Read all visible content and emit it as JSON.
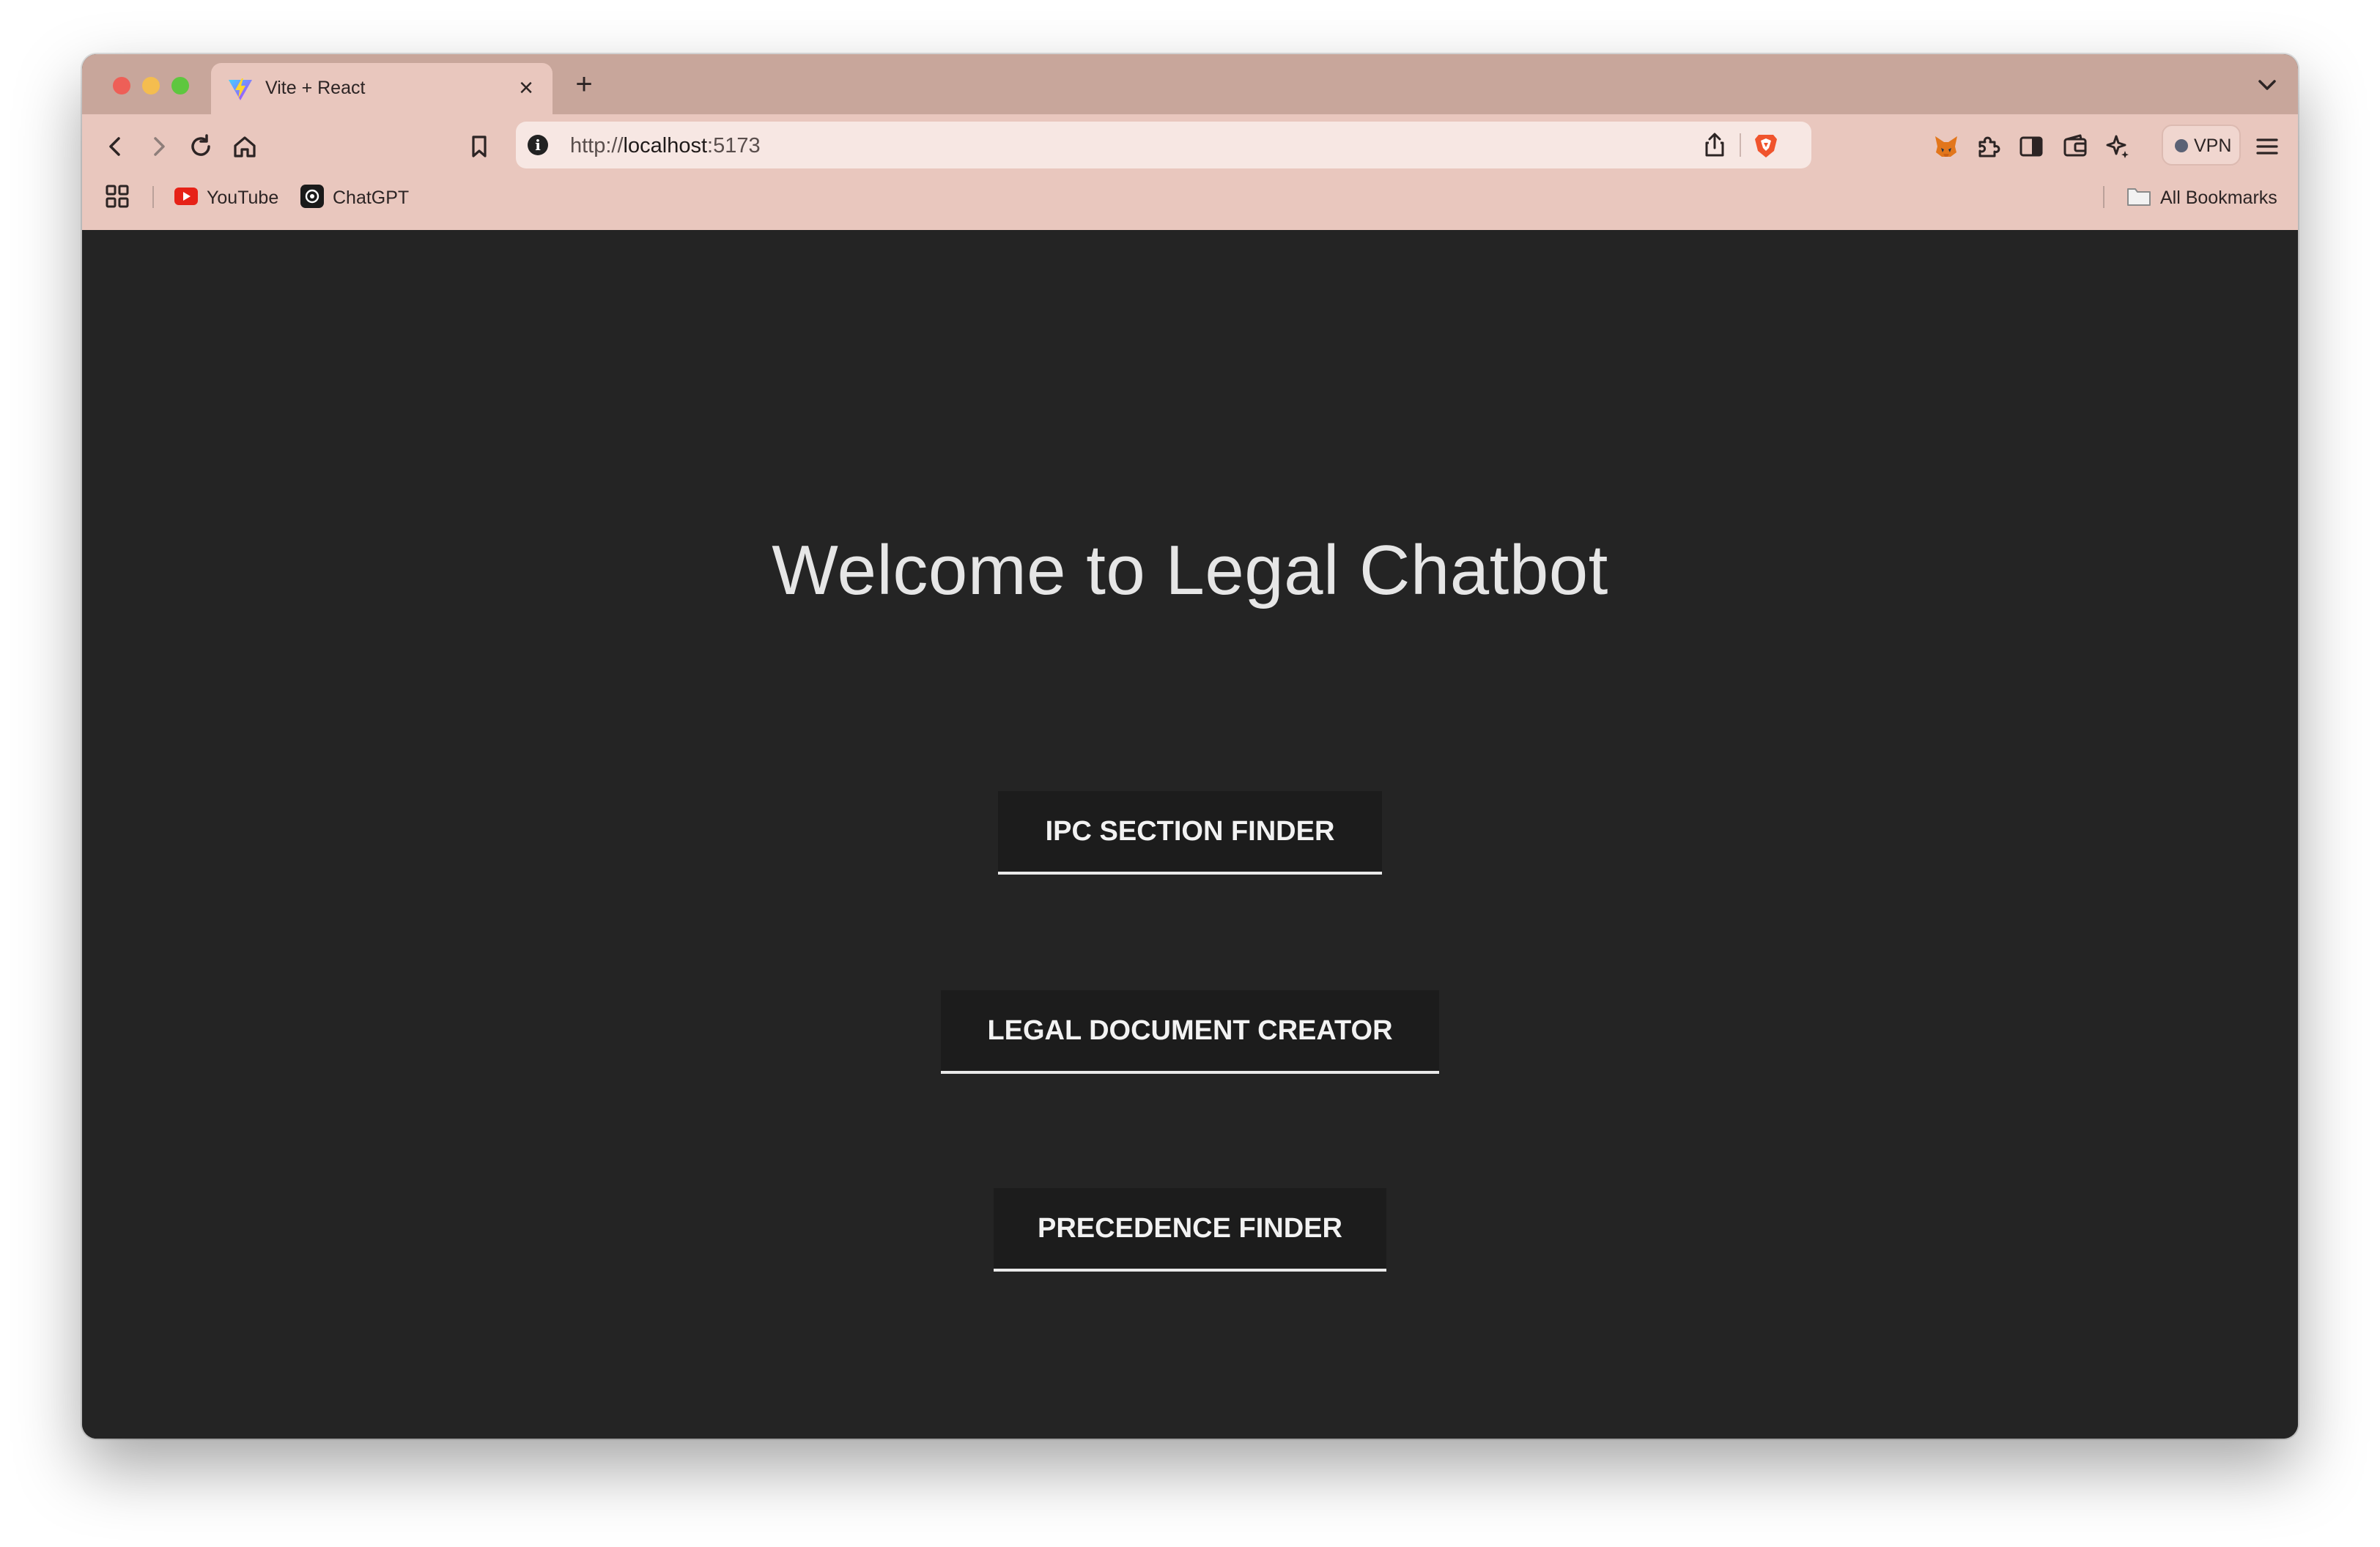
{
  "browser": {
    "tab": {
      "title": "Vite + React",
      "close": "×"
    },
    "new_tab": "+",
    "address": {
      "scheme": "http://",
      "host": "localhost",
      "port": ":5173"
    },
    "vpn_label": "VPN",
    "bookmarks": [
      {
        "label": "YouTube",
        "icon": "youtube-icon"
      },
      {
        "label": "ChatGPT",
        "icon": "chatgpt-icon"
      }
    ],
    "all_bookmarks": "All Bookmarks"
  },
  "page": {
    "title": "Welcome to Legal Chatbot",
    "buttons": [
      {
        "label": "IPC SECTION FINDER"
      },
      {
        "label": "LEGAL DOCUMENT CREATOR"
      },
      {
        "label": "PRECEDENCE FINDER"
      }
    ]
  },
  "colors": {
    "browser_chrome": "#e9c7be",
    "tab_strip": "#c8a69b",
    "page_background": "#242424",
    "button_background": "#1c1c1c",
    "button_underline": "#e9e9e9",
    "heading_text": "#e6e6e6"
  }
}
